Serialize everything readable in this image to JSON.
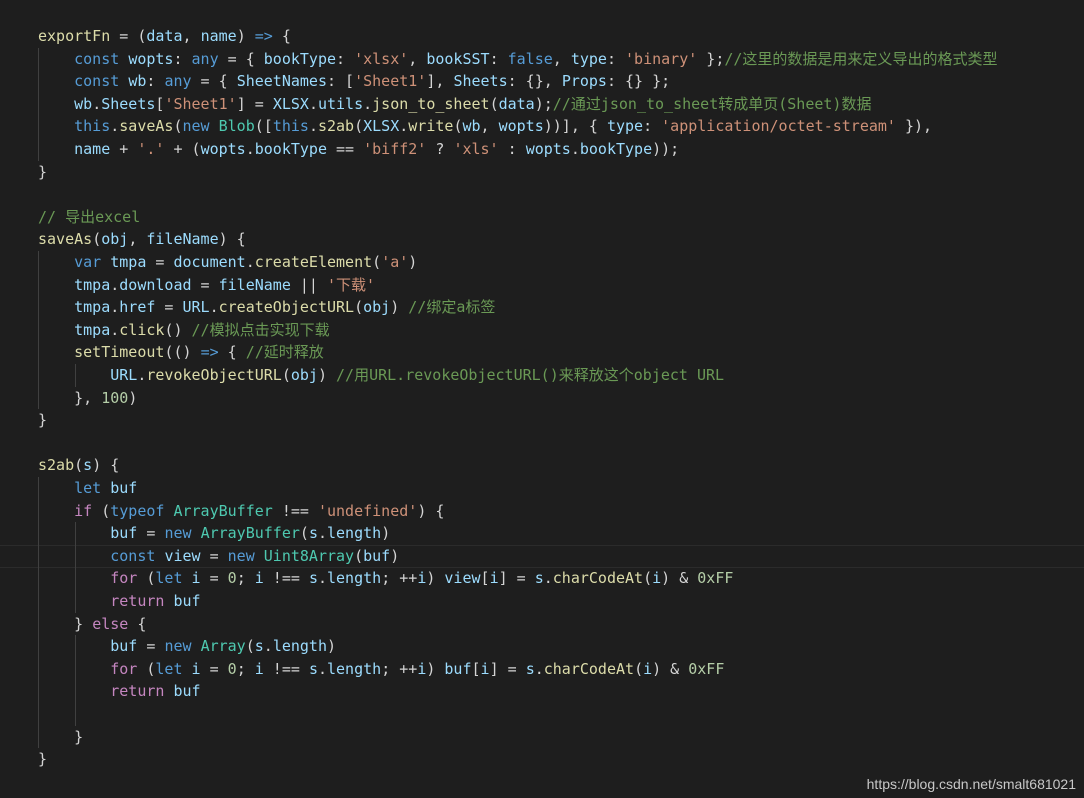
{
  "code_lines": [
    [
      [
        "exportFn",
        "fn"
      ],
      [
        " = (",
        "op"
      ],
      [
        "data",
        "var"
      ],
      [
        ", ",
        "op"
      ],
      [
        "name",
        "var"
      ],
      [
        ") ",
        "op"
      ],
      [
        "=>",
        "kw"
      ],
      [
        " {",
        "op"
      ]
    ],
    [
      [
        "    ",
        "op"
      ],
      [
        "const",
        "kw"
      ],
      [
        " ",
        "op"
      ],
      [
        "wopts",
        "var"
      ],
      [
        ": ",
        "op"
      ],
      [
        "any",
        "kw"
      ],
      [
        " = { ",
        "op"
      ],
      [
        "bookType",
        "var"
      ],
      [
        ": ",
        "op"
      ],
      [
        "'xlsx'",
        "str"
      ],
      [
        ", ",
        "op"
      ],
      [
        "bookSST",
        "var"
      ],
      [
        ": ",
        "op"
      ],
      [
        "false",
        "kw"
      ],
      [
        ", ",
        "op"
      ],
      [
        "type",
        "var"
      ],
      [
        ": ",
        "op"
      ],
      [
        "'binary'",
        "str"
      ],
      [
        " };",
        "op"
      ],
      [
        "//这里的数据是用来定义导出的格式类型",
        "cmt"
      ]
    ],
    [
      [
        "    ",
        "op"
      ],
      [
        "const",
        "kw"
      ],
      [
        " ",
        "op"
      ],
      [
        "wb",
        "var"
      ],
      [
        ": ",
        "op"
      ],
      [
        "any",
        "kw"
      ],
      [
        " = { ",
        "op"
      ],
      [
        "SheetNames",
        "var"
      ],
      [
        ": [",
        "op"
      ],
      [
        "'Sheet1'",
        "str"
      ],
      [
        "], ",
        "op"
      ],
      [
        "Sheets",
        "var"
      ],
      [
        ": {}, ",
        "op"
      ],
      [
        "Props",
        "var"
      ],
      [
        ": {} };",
        "op"
      ]
    ],
    [
      [
        "    ",
        "op"
      ],
      [
        "wb",
        "var"
      ],
      [
        ".",
        "op"
      ],
      [
        "Sheets",
        "var"
      ],
      [
        "[",
        "op"
      ],
      [
        "'Sheet1'",
        "str"
      ],
      [
        "] = ",
        "op"
      ],
      [
        "XLSX",
        "var"
      ],
      [
        ".",
        "op"
      ],
      [
        "utils",
        "var"
      ],
      [
        ".",
        "op"
      ],
      [
        "json_to_sheet",
        "fn"
      ],
      [
        "(",
        "op"
      ],
      [
        "data",
        "var"
      ],
      [
        ");",
        "op"
      ],
      [
        "//通过json_to_sheet转成单页(Sheet)数据",
        "cmt"
      ]
    ],
    [
      [
        "    ",
        "op"
      ],
      [
        "this",
        "kw"
      ],
      [
        ".",
        "op"
      ],
      [
        "saveAs",
        "fn"
      ],
      [
        "(",
        "op"
      ],
      [
        "new",
        "kw"
      ],
      [
        " ",
        "op"
      ],
      [
        "Blob",
        "typ"
      ],
      [
        "([",
        "op"
      ],
      [
        "this",
        "kw"
      ],
      [
        ".",
        "op"
      ],
      [
        "s2ab",
        "fn"
      ],
      [
        "(",
        "op"
      ],
      [
        "XLSX",
        "var"
      ],
      [
        ".",
        "op"
      ],
      [
        "write",
        "fn"
      ],
      [
        "(",
        "op"
      ],
      [
        "wb",
        "var"
      ],
      [
        ", ",
        "op"
      ],
      [
        "wopts",
        "var"
      ],
      [
        "))], { ",
        "op"
      ],
      [
        "type",
        "var"
      ],
      [
        ": ",
        "op"
      ],
      [
        "'application/octet-stream'",
        "str"
      ],
      [
        " }),",
        "op"
      ]
    ],
    [
      [
        "    ",
        "op"
      ],
      [
        "name",
        "var"
      ],
      [
        " + ",
        "op"
      ],
      [
        "'.'",
        "str"
      ],
      [
        " + (",
        "op"
      ],
      [
        "wopts",
        "var"
      ],
      [
        ".",
        "op"
      ],
      [
        "bookType",
        "var"
      ],
      [
        " == ",
        "op"
      ],
      [
        "'biff2'",
        "str"
      ],
      [
        " ? ",
        "op"
      ],
      [
        "'xls'",
        "str"
      ],
      [
        " : ",
        "op"
      ],
      [
        "wopts",
        "var"
      ],
      [
        ".",
        "op"
      ],
      [
        "bookType",
        "var"
      ],
      [
        "));",
        "op"
      ]
    ],
    [
      [
        "}",
        "op"
      ]
    ],
    [],
    [
      [
        "// 导出excel",
        "cmt"
      ]
    ],
    [
      [
        "saveAs",
        "fn"
      ],
      [
        "(",
        "op"
      ],
      [
        "obj",
        "var"
      ],
      [
        ", ",
        "op"
      ],
      [
        "fileName",
        "var"
      ],
      [
        ") {",
        "op"
      ]
    ],
    [
      [
        "    ",
        "op"
      ],
      [
        "var",
        "kw"
      ],
      [
        " ",
        "op"
      ],
      [
        "tmpa",
        "var"
      ],
      [
        " = ",
        "op"
      ],
      [
        "document",
        "var"
      ],
      [
        ".",
        "op"
      ],
      [
        "createElement",
        "fn"
      ],
      [
        "(",
        "op"
      ],
      [
        "'a'",
        "str"
      ],
      [
        ")",
        "op"
      ]
    ],
    [
      [
        "    ",
        "op"
      ],
      [
        "tmpa",
        "var"
      ],
      [
        ".",
        "op"
      ],
      [
        "download",
        "var"
      ],
      [
        " = ",
        "op"
      ],
      [
        "fileName",
        "var"
      ],
      [
        " || ",
        "op"
      ],
      [
        "'下载'",
        "str"
      ]
    ],
    [
      [
        "    ",
        "op"
      ],
      [
        "tmpa",
        "var"
      ],
      [
        ".",
        "op"
      ],
      [
        "href",
        "var"
      ],
      [
        " = ",
        "op"
      ],
      [
        "URL",
        "var"
      ],
      [
        ".",
        "op"
      ],
      [
        "createObjectURL",
        "fn"
      ],
      [
        "(",
        "op"
      ],
      [
        "obj",
        "var"
      ],
      [
        ") ",
        "op"
      ],
      [
        "//绑定a标签",
        "cmt"
      ]
    ],
    [
      [
        "    ",
        "op"
      ],
      [
        "tmpa",
        "var"
      ],
      [
        ".",
        "op"
      ],
      [
        "click",
        "fn"
      ],
      [
        "() ",
        "op"
      ],
      [
        "//模拟点击实现下载",
        "cmt"
      ]
    ],
    [
      [
        "    ",
        "op"
      ],
      [
        "setTimeout",
        "fn"
      ],
      [
        "(() ",
        "op"
      ],
      [
        "=>",
        "kw"
      ],
      [
        " { ",
        "op"
      ],
      [
        "//延时释放",
        "cmt"
      ]
    ],
    [
      [
        "        ",
        "op"
      ],
      [
        "URL",
        "var"
      ],
      [
        ".",
        "op"
      ],
      [
        "revokeObjectURL",
        "fn"
      ],
      [
        "(",
        "op"
      ],
      [
        "obj",
        "var"
      ],
      [
        ") ",
        "op"
      ],
      [
        "//用URL.revokeObjectURL()来释放这个object URL",
        "cmt"
      ]
    ],
    [
      [
        "    ",
        "op"
      ],
      [
        "}, ",
        "op"
      ],
      [
        "100",
        "num"
      ],
      [
        ")",
        "op"
      ]
    ],
    [
      [
        "}",
        "op"
      ]
    ],
    [],
    [
      [
        "s2ab",
        "fn"
      ],
      [
        "(",
        "op"
      ],
      [
        "s",
        "var"
      ],
      [
        ") {",
        "op"
      ]
    ],
    [
      [
        "    ",
        "op"
      ],
      [
        "let",
        "kw"
      ],
      [
        " ",
        "op"
      ],
      [
        "buf",
        "var"
      ]
    ],
    [
      [
        "    ",
        "op"
      ],
      [
        "if",
        "ctl"
      ],
      [
        " (",
        "op"
      ],
      [
        "typeof",
        "kw"
      ],
      [
        " ",
        "op"
      ],
      [
        "ArrayBuffer",
        "typ"
      ],
      [
        " !== ",
        "op"
      ],
      [
        "'undefined'",
        "str"
      ],
      [
        ") {",
        "op"
      ]
    ],
    [
      [
        "        ",
        "op"
      ],
      [
        "buf",
        "var"
      ],
      [
        " = ",
        "op"
      ],
      [
        "new",
        "kw"
      ],
      [
        " ",
        "op"
      ],
      [
        "ArrayBuffer",
        "typ"
      ],
      [
        "(",
        "op"
      ],
      [
        "s",
        "var"
      ],
      [
        ".",
        "op"
      ],
      [
        "length",
        "var"
      ],
      [
        ")",
        "op"
      ]
    ],
    [
      [
        "        ",
        "op"
      ],
      [
        "const",
        "kw"
      ],
      [
        " ",
        "op"
      ],
      [
        "view",
        "var"
      ],
      [
        " = ",
        "op"
      ],
      [
        "new",
        "kw"
      ],
      [
        " ",
        "op"
      ],
      [
        "Uint8Array",
        "typ"
      ],
      [
        "(",
        "op"
      ],
      [
        "buf",
        "var"
      ],
      [
        ")",
        "op"
      ]
    ],
    [
      [
        "        ",
        "op"
      ],
      [
        "for",
        "ctl"
      ],
      [
        " (",
        "op"
      ],
      [
        "let",
        "kw"
      ],
      [
        " ",
        "op"
      ],
      [
        "i",
        "var"
      ],
      [
        " = ",
        "op"
      ],
      [
        "0",
        "num"
      ],
      [
        "; ",
        "op"
      ],
      [
        "i",
        "var"
      ],
      [
        " !== ",
        "op"
      ],
      [
        "s",
        "var"
      ],
      [
        ".",
        "op"
      ],
      [
        "length",
        "var"
      ],
      [
        "; ++",
        "op"
      ],
      [
        "i",
        "var"
      ],
      [
        ") ",
        "op"
      ],
      [
        "view",
        "var"
      ],
      [
        "[",
        "op"
      ],
      [
        "i",
        "var"
      ],
      [
        "] = ",
        "op"
      ],
      [
        "s",
        "var"
      ],
      [
        ".",
        "op"
      ],
      [
        "charCodeAt",
        "fn"
      ],
      [
        "(",
        "op"
      ],
      [
        "i",
        "var"
      ],
      [
        ") & ",
        "op"
      ],
      [
        "0xFF",
        "num"
      ]
    ],
    [
      [
        "        ",
        "op"
      ],
      [
        "return",
        "ctl"
      ],
      [
        " ",
        "op"
      ],
      [
        "buf",
        "var"
      ]
    ],
    [
      [
        "    ",
        "op"
      ],
      [
        "} ",
        "op"
      ],
      [
        "else",
        "ctl"
      ],
      [
        " {",
        "op"
      ]
    ],
    [
      [
        "        ",
        "op"
      ],
      [
        "buf",
        "var"
      ],
      [
        " = ",
        "op"
      ],
      [
        "new",
        "kw"
      ],
      [
        " ",
        "op"
      ],
      [
        "Array",
        "typ"
      ],
      [
        "(",
        "op"
      ],
      [
        "s",
        "var"
      ],
      [
        ".",
        "op"
      ],
      [
        "length",
        "var"
      ],
      [
        ")",
        "op"
      ]
    ],
    [
      [
        "        ",
        "op"
      ],
      [
        "for",
        "ctl"
      ],
      [
        " (",
        "op"
      ],
      [
        "let",
        "kw"
      ],
      [
        " ",
        "op"
      ],
      [
        "i",
        "var"
      ],
      [
        " = ",
        "op"
      ],
      [
        "0",
        "num"
      ],
      [
        "; ",
        "op"
      ],
      [
        "i",
        "var"
      ],
      [
        " !== ",
        "op"
      ],
      [
        "s",
        "var"
      ],
      [
        ".",
        "op"
      ],
      [
        "length",
        "var"
      ],
      [
        "; ++",
        "op"
      ],
      [
        "i",
        "var"
      ],
      [
        ") ",
        "op"
      ],
      [
        "buf",
        "var"
      ],
      [
        "[",
        "op"
      ],
      [
        "i",
        "var"
      ],
      [
        "] = ",
        "op"
      ],
      [
        "s",
        "var"
      ],
      [
        ".",
        "op"
      ],
      [
        "charCodeAt",
        "fn"
      ],
      [
        "(",
        "op"
      ],
      [
        "i",
        "var"
      ],
      [
        ") & ",
        "op"
      ],
      [
        "0xFF",
        "num"
      ]
    ],
    [
      [
        "        ",
        "op"
      ],
      [
        "return",
        "ctl"
      ],
      [
        " ",
        "op"
      ],
      [
        "buf",
        "var"
      ]
    ],
    [],
    [
      [
        "    ",
        "op"
      ],
      [
        "}",
        "op"
      ]
    ],
    [
      [
        "}",
        "op"
      ]
    ]
  ],
  "current_line": 23,
  "watermark": "https://blog.csdn.net/smalt681021",
  "colors": {
    "background": "#1e1e1e",
    "keyword": "#569cd6",
    "control": "#c586c0",
    "string": "#ce9178",
    "comment": "#6a9955",
    "number": "#b5cea8",
    "type": "#4ec9b0",
    "function": "#dcdcaa",
    "variable": "#9cdcfe",
    "plain": "#d4d4d4"
  }
}
